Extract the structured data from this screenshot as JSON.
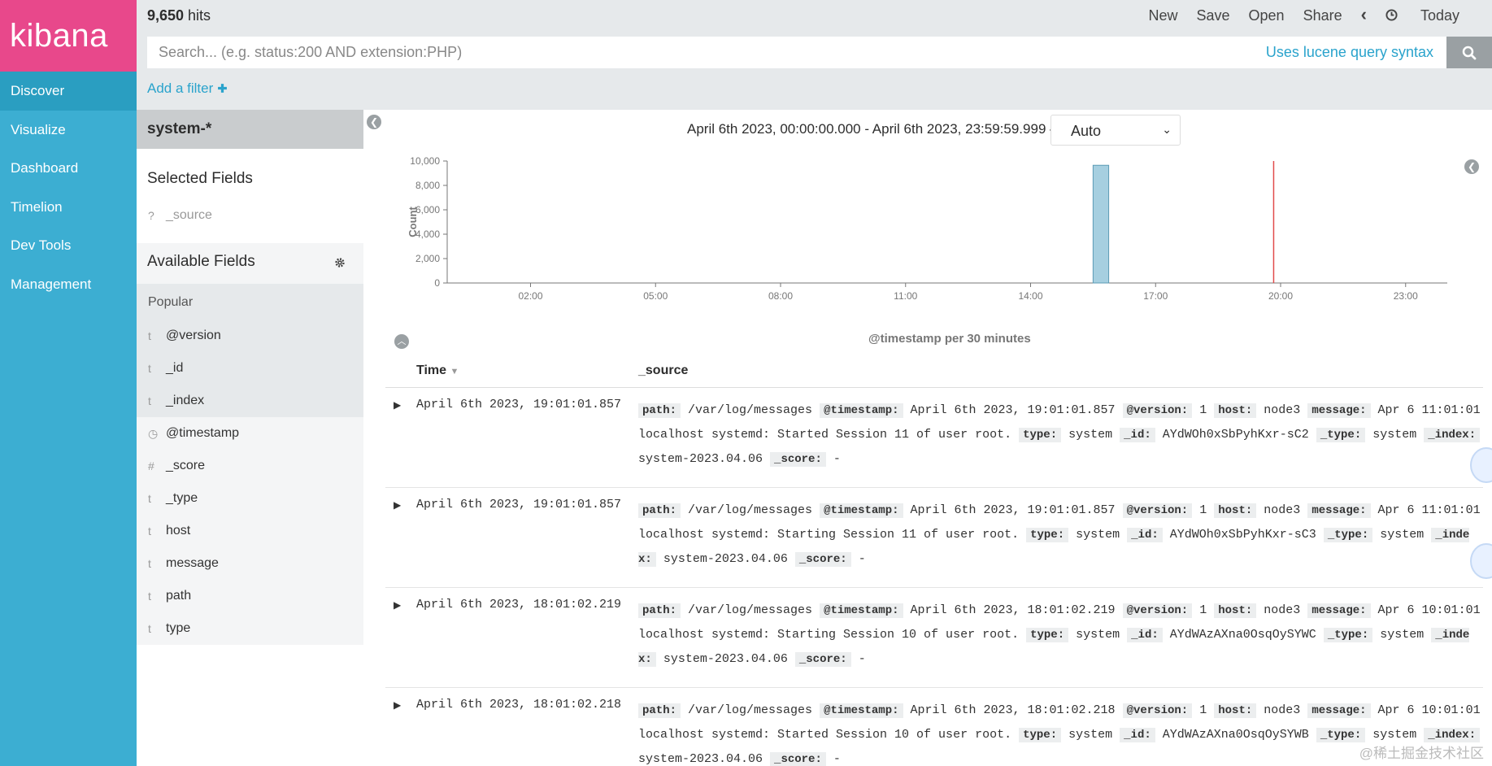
{
  "app": {
    "logo": "kibana"
  },
  "nav": {
    "items": [
      {
        "label": "Discover"
      },
      {
        "label": "Visualize"
      },
      {
        "label": "Dashboard"
      },
      {
        "label": "Timelion"
      },
      {
        "label": "Dev Tools"
      },
      {
        "label": "Management"
      }
    ]
  },
  "topbar": {
    "hits_count": "9,650",
    "hits_label": " hits",
    "menu": [
      "New",
      "Save",
      "Open",
      "Share"
    ],
    "prev_icon": "‹",
    "time_label": "Today",
    "search_placeholder": "Search... (e.g. status:200 AND extension:PHP)",
    "lucene_link": "Uses lucene query syntax",
    "add_filter": "Add a filter"
  },
  "sidebar": {
    "index_pattern": "system-*",
    "selected_title": "Selected Fields",
    "selected_fields": [
      {
        "type": "?",
        "name": "_source"
      }
    ],
    "available_title": "Available Fields",
    "popular_label": "Popular",
    "popular_fields": [
      {
        "type": "t",
        "name": "@version"
      },
      {
        "type": "t",
        "name": "_id"
      },
      {
        "type": "t",
        "name": "_index"
      }
    ],
    "other_fields": [
      {
        "type": "◷",
        "name": "@timestamp"
      },
      {
        "type": "#",
        "name": "_score"
      },
      {
        "type": "t",
        "name": "_type"
      },
      {
        "type": "t",
        "name": "host"
      },
      {
        "type": "t",
        "name": "message"
      },
      {
        "type": "t",
        "name": "path"
      },
      {
        "type": "t",
        "name": "type"
      }
    ]
  },
  "main": {
    "time_range": "April 6th 2023, 00:00:00.000 - April 6th 2023, 23:59:59.999 —",
    "interval": "Auto"
  },
  "chart_data": {
    "type": "bar",
    "ylabel": "Count",
    "xlabel": "@timestamp per 30 minutes",
    "ylim": [
      0,
      10000
    ],
    "yticks": [
      "0",
      "2,000",
      "4,000",
      "6,000",
      "8,000",
      "10,000"
    ],
    "xticks": [
      "02:00",
      "05:00",
      "08:00",
      "11:00",
      "14:00",
      "17:00",
      "20:00",
      "23:00"
    ],
    "bars": [
      {
        "x": "15:30",
        "value": 9650
      }
    ],
    "now_marker": "19:50",
    "colors": {
      "bar": "#a6cfe0",
      "bar_stroke": "#5c9bb5",
      "marker": "#e24b4b"
    }
  },
  "table": {
    "col_time": "Time",
    "col_source": "_source",
    "rows": [
      {
        "time": "April 6th 2023, 19:01:01.857",
        "path": "/var/log/messages",
        "timestamp": "April 6th 2023, 19:01:01.857",
        "version": "1",
        "host": "node3",
        "message": "Apr 6 11:01:01 localhost systemd: Started Session 11 of user root.",
        "type": "system",
        "id": "AYdWOh0xSbPyhKxr-sC2",
        "_type": "system",
        "index": "system-2023.04.06",
        "score": "-"
      },
      {
        "time": "April 6th 2023, 19:01:01.857",
        "path": "/var/log/messages",
        "timestamp": "April 6th 2023, 19:01:01.857",
        "version": "1",
        "host": "node3",
        "message": "Apr 6 11:01:01 localhost systemd: Starting Session 11 of user root.",
        "type": "system",
        "id": "AYdWOh0xSbPyhKxr-sC3",
        "_type": "system",
        "index": "system-2023.04.06",
        "score": "-"
      },
      {
        "time": "April 6th 2023, 18:01:02.219",
        "path": "/var/log/messages",
        "timestamp": "April 6th 2023, 18:01:02.219",
        "version": "1",
        "host": "node3",
        "message": "Apr 6 10:01:01 localhost systemd: Starting Session 10 of user root.",
        "type": "system",
        "id": "AYdWAzAXna0OsqOySYWC",
        "_type": "system",
        "index": "system-2023.04.06",
        "score": "-"
      },
      {
        "time": "April 6th 2023, 18:01:02.218",
        "path": "/var/log/messages",
        "timestamp": "April 6th 2023, 18:01:02.218",
        "version": "1",
        "host": "node3",
        "message": "Apr 6 10:01:01 localhost systemd: Started Session 10 of user root.",
        "type": "system",
        "id": "AYdWAzAXna0OsqOySYWB",
        "_type": "system",
        "index": "system-2023.04.06",
        "score": "-"
      }
    ],
    "keys": {
      "path": "path:",
      "timestamp": "@timestamp:",
      "version": "@version:",
      "host": "host:",
      "message": "message:",
      "type": "type:",
      "id": "_id:",
      "_type": "_type:",
      "index": "_index:",
      "score": "_score:"
    }
  },
  "watermark": "@稀土掘金技术社区"
}
